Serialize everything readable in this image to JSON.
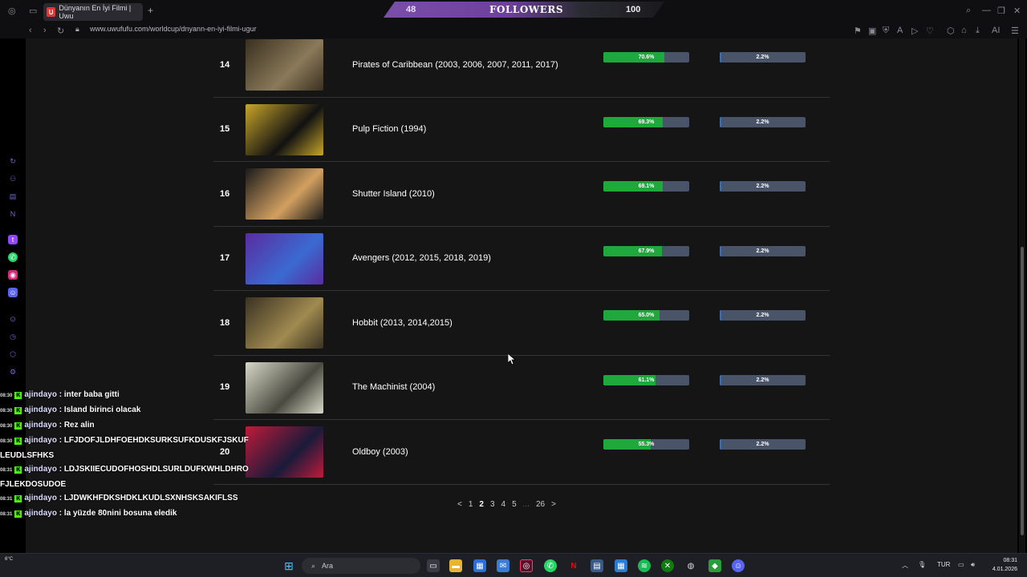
{
  "browser": {
    "tab_title": "Dünyanın En İyi Filmi | Uwu",
    "tab_favicon": "U",
    "url": "www.uwufufu.com/worldcup/dnyann-en-iyi-filmi-ugur"
  },
  "followers_overlay": {
    "current": "48",
    "label": "FOLLOWERS",
    "goal": "100"
  },
  "rankings": [
    {
      "rank": "14",
      "title": "Pirates of Caribbean (2003, 2006, 2007, 2011, 2017)",
      "win_rate": 70.6,
      "win_label": "70.6%",
      "champ_rate": 2.2,
      "champ_label": "2.2%",
      "poster_colors": [
        "#3a3020",
        "#8a7a5a"
      ]
    },
    {
      "rank": "15",
      "title": "Pulp Fiction (1994)",
      "win_rate": 69.3,
      "win_label": "69.3%",
      "champ_rate": 2.2,
      "champ_label": "2.2%",
      "poster_colors": [
        "#c9a62a",
        "#111111"
      ]
    },
    {
      "rank": "16",
      "title": "Shutter Island (2010)",
      "win_rate": 69.1,
      "win_label": "69.1%",
      "champ_rate": 2.2,
      "champ_label": "2.2%",
      "poster_colors": [
        "#1a1a1a",
        "#d2a060"
      ]
    },
    {
      "rank": "17",
      "title": "Avengers (2012, 2015, 2018, 2019)",
      "win_rate": 67.9,
      "win_label": "67.9%",
      "champ_rate": 2.2,
      "champ_label": "2.2%",
      "poster_colors": [
        "#5a2ca0",
        "#3a6ad0"
      ]
    },
    {
      "rank": "18",
      "title": "Hobbit (2013, 2014,2015)",
      "win_rate": 65.0,
      "win_label": "65.0%",
      "champ_rate": 2.2,
      "champ_label": "2.2%",
      "poster_colors": [
        "#3a3222",
        "#a08a50"
      ]
    },
    {
      "rank": "19",
      "title": "The Machinist (2004)",
      "win_rate": 61.1,
      "win_label": "61.1%",
      "champ_rate": 2.2,
      "champ_label": "2.2%",
      "poster_colors": [
        "#d8d8c8",
        "#4a4a40"
      ]
    },
    {
      "rank": "20",
      "title": "Oldboy (2003)",
      "win_rate": 55.3,
      "win_label": "55.3%",
      "champ_rate": 2.2,
      "champ_label": "2.2%",
      "poster_colors": [
        "#c01a3a",
        "#1a1a3a"
      ]
    }
  ],
  "pagination": {
    "prev": "<",
    "pages": [
      "1",
      "2",
      "3",
      "4",
      "5",
      "...",
      "26"
    ],
    "active": "2",
    "next": ">"
  },
  "chat": [
    {
      "time": "08:30",
      "user": "ajindayo",
      "sep": " : ",
      "text": "inter baba gitti"
    },
    {
      "time": "08:30",
      "user": "ajindayo",
      "sep": " : ",
      "text": "Island birinci olacak"
    },
    {
      "time": "08:30",
      "user": "ajindayo",
      "sep": " : ",
      "text": "Rez alin"
    },
    {
      "time": "08:30",
      "user": "ajindayo",
      "sep": " : ",
      "text": "LFJDOFJLDHFOEHDKSURKSUFKDUSKFJSKUFLEUDLSFHKS"
    },
    {
      "time": "08:31",
      "user": "ajindayo",
      "sep": " : ",
      "text": "LDJSKIIECUDOFHOSHDLSURLDUFKWHLDHROFJLEKDOSUDOE"
    },
    {
      "time": "08:31",
      "user": "ajindayo",
      "sep": " : ",
      "text": "LJDWKHFDKSHDKLKUDLSXNHSKSAKIFLSS"
    },
    {
      "time": "08:31",
      "user": "ajindayo",
      "sep": " : ",
      "text": "la yüzde 80nini bosuna eledik"
    }
  ],
  "taskbar": {
    "search_placeholder": "Ara",
    "lang": "TUR",
    "time": "08:31",
    "date": "4.01.2026",
    "weather": "6°C"
  },
  "colors": {
    "win_bar": "#1fa83c",
    "champ_bar": "#2d6fd1",
    "bar_track": "#4a5468",
    "page_bg": "#151515"
  }
}
